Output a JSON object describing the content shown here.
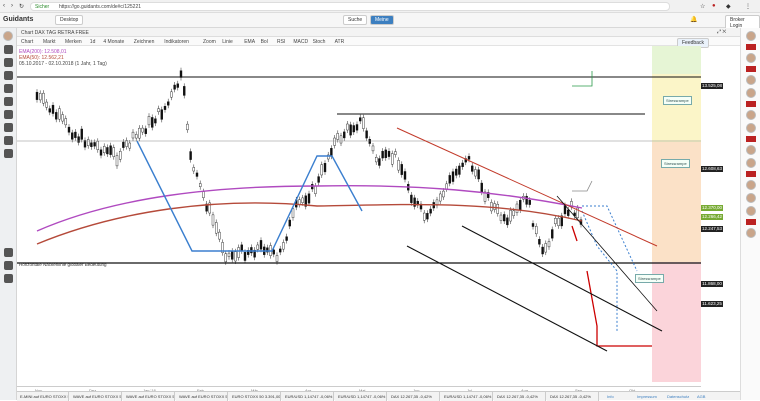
{
  "browser": {
    "url_prefix": "Sicher",
    "url": "https://go.guidants.com/de#c/125221",
    "tabs": [
      "Suche",
      "Meine"
    ]
  },
  "app": {
    "logo": "Guidants",
    "header_left_label": "Desktop",
    "header_right_label": "Broker Login"
  },
  "chart": {
    "window_title": "Chart DAX TAG RETRA FREE",
    "toolbar": [
      "Chart",
      "Markt",
      "Merken",
      "1d",
      "4 Monate",
      "Zeichnen",
      "Indikatoren",
      "Zoom",
      "Linie",
      "EMA",
      "Bol",
      "RSI",
      "MACD",
      "Stoch",
      "ATR"
    ],
    "legend": [
      "EMA(200): 12.508,01",
      "EMA(50): 12.562,21",
      "05.10.2017 - 02.10.2018 (1 Jahr, 1 Tag)"
    ],
    "feedback_label": "Feedback",
    "annotation_label": "Horizontale Nackenlinie globaler Bedeutung",
    "zone_labels": [
      "Stressrampe",
      "Stressrampe",
      "Stressrampe"
    ],
    "price_boxes": [
      {
        "label": "13.525,08",
        "color": "#222"
      },
      {
        "label": "12.608,63",
        "color": "#222"
      },
      {
        "label": "12.370,00",
        "color": "#7a3"
      },
      {
        "label": "12.266,42",
        "color": "#7a3"
      },
      {
        "label": "12.247,53",
        "color": "#222"
      },
      {
        "label": "11.868,00",
        "color": "#222"
      },
      {
        "label": "11.623,25",
        "color": "#222"
      }
    ],
    "x_axis": [
      "Nov",
      "Dez",
      "Jan '18",
      "Feb",
      "Mär",
      "Apr",
      "Mai",
      "Jun",
      "Jul",
      "Aug",
      "Sep",
      "Okt"
    ]
  },
  "bottom_tabs": [
    "E-MINI auf EURO STOXX 50",
    "WAVE auf EURO STOXX 50",
    "WAVE auf EURO STOXX 50",
    "WAVE auf EURO STOXX 50",
    "EURO STOXX 50 3.391,00 -0,69%",
    "EUR/USD 1,14747 -0,06%",
    "EUR/USD 1,14747 -0,06%",
    "DAX 12.267,35 -0,42%",
    "EUR/USD 1,14747 -0,06%",
    "DAX 12.267,35 -0,42%",
    "DAX 12.267,35 -0,42%"
  ],
  "bottom_links": [
    "Info",
    "Impressum",
    "Datenschutz",
    "AGB"
  ],
  "colors": {
    "zone_yellow": "#fbf5c8",
    "zone_green": "#e6f5d5",
    "zone_orange": "#fbe1c7",
    "zone_pink": "#fbd4da",
    "ema_red": "#b54a3a",
    "ema_magenta": "#b04ac0",
    "trend_blue": "#3b7fcf",
    "trend_red": "#c23a2a"
  }
}
